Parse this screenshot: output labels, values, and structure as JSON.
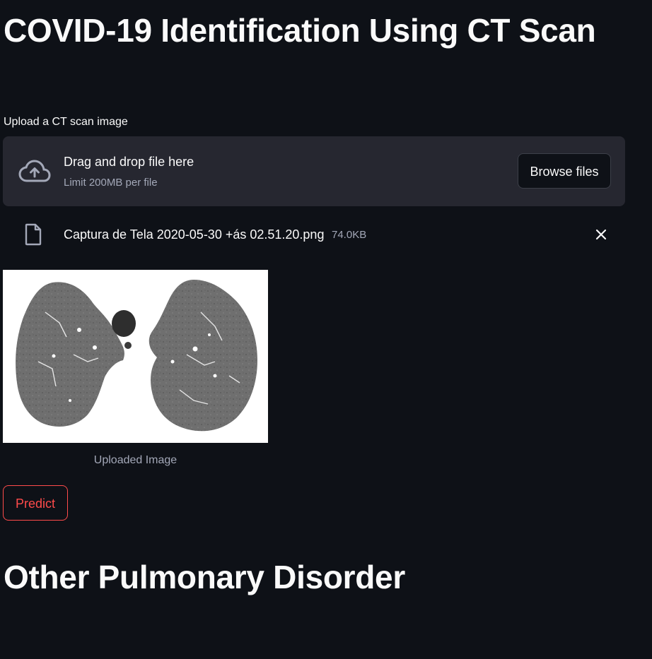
{
  "page": {
    "title": "COVID-19 Identification Using CT Scan",
    "subtitle": "Other Pulmonary Disorder"
  },
  "uploader": {
    "label": "Upload a CT scan image",
    "drop_text": "Drag and drop file here",
    "limit_text": "Limit 200MB per file",
    "browse_label": "Browse files",
    "icon": "cloud-upload-icon"
  },
  "uploaded_file": {
    "name": "Captura de Tela 2020-05-30 +ás 02.51.20.png",
    "size": "74.0KB",
    "icon": "file-icon",
    "remove_icon": "close-icon"
  },
  "image": {
    "caption": "Uploaded Image"
  },
  "actions": {
    "predict_label": "Predict"
  },
  "colors": {
    "background": "#0e1117",
    "panel": "#262730",
    "text": "#fafafa",
    "muted": "#a3a8b8",
    "accent": "#ff4b4b"
  }
}
